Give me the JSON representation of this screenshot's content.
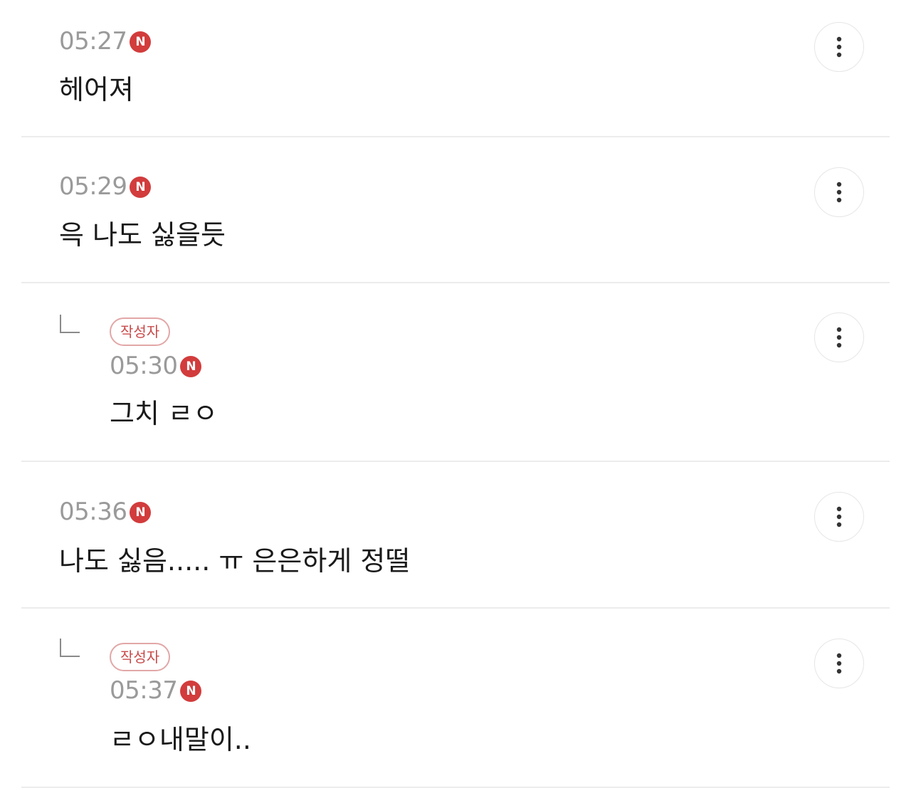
{
  "comments": [
    {
      "time": "05:27",
      "badge": "N",
      "text": "헤어져",
      "is_reply": false
    },
    {
      "time": "05:29",
      "badge": "N",
      "text": "윽 나도 싫을듯",
      "is_reply": false
    },
    {
      "time": "05:30",
      "badge": "N",
      "text": "그치 ㄹㅇ",
      "is_reply": true,
      "author_label": "작성자"
    },
    {
      "time": "05:36",
      "badge": "N",
      "text": "나도 싫음..... ㅠ 은은하게 정떨",
      "is_reply": false
    },
    {
      "time": "05:37",
      "badge": "N",
      "text": "ㄹㅇ내말이..",
      "is_reply": true,
      "author_label": "작성자"
    }
  ],
  "icons": {
    "more": "more-vertical-icon",
    "reply": "reply-arrow-icon",
    "new": "new-badge-icon"
  },
  "colors": {
    "new_badge": "#d23c3c",
    "author_badge_border": "#e2a7a7",
    "author_badge_text": "#c94a4a",
    "time_text": "#9a9a9a",
    "divider": "#ececec"
  }
}
